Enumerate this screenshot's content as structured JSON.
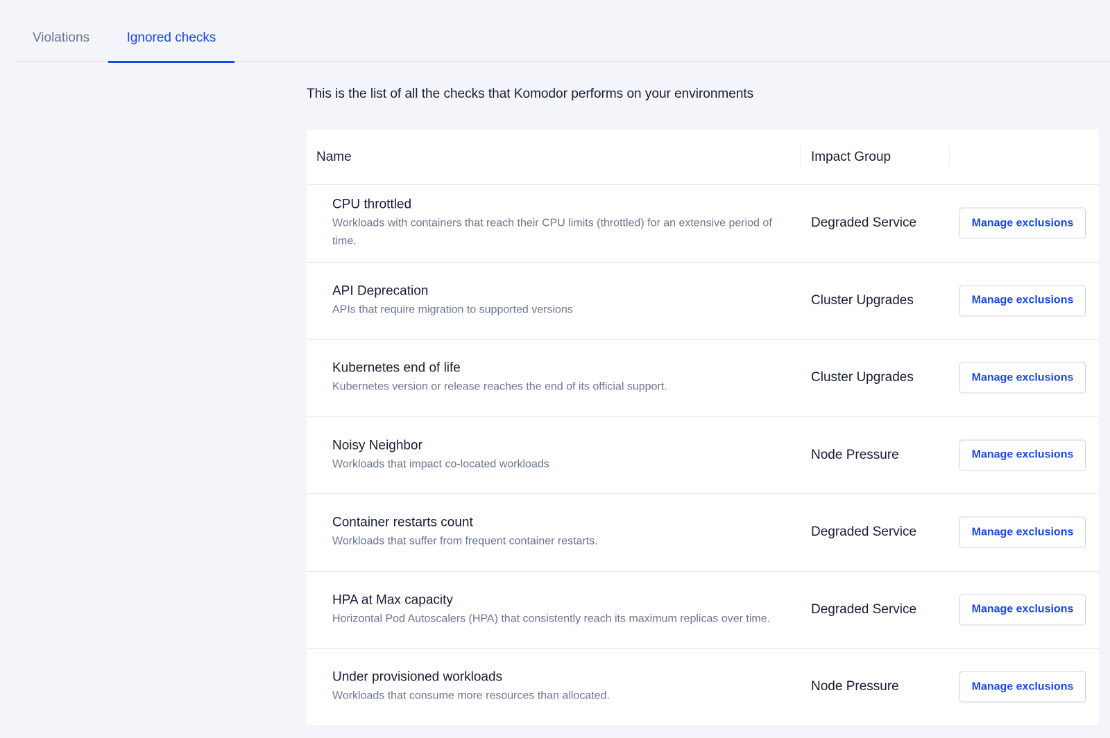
{
  "tabs": [
    {
      "label": "Violations",
      "active": false
    },
    {
      "label": "Ignored checks",
      "active": true
    }
  ],
  "intro": "This is the list of all the checks that Komodor performs on your environments",
  "table": {
    "headers": {
      "name": "Name",
      "impact_group": "Impact Group"
    },
    "rows": [
      {
        "title": "CPU throttled",
        "description": "Workloads with containers that reach their CPU limits (throttled) for an extensive period of time.",
        "impact_group": "Degraded Service",
        "action": "Manage exclusions"
      },
      {
        "title": "API Deprecation",
        "description": "APIs that require migration to supported versions",
        "impact_group": "Cluster Upgrades",
        "action": "Manage exclusions"
      },
      {
        "title": "Kubernetes end of life",
        "description": "Kubernetes version or release reaches the end of its official support.",
        "impact_group": "Cluster Upgrades",
        "action": "Manage exclusions"
      },
      {
        "title": "Noisy Neighbor",
        "description": "Workloads that impact co-located workloads",
        "impact_group": "Node Pressure",
        "action": "Manage exclusions"
      },
      {
        "title": "Container restarts count",
        "description": "Workloads that suffer from frequent container restarts.",
        "impact_group": "Degraded Service",
        "action": "Manage exclusions"
      },
      {
        "title": "HPA at Max capacity",
        "description": "Horizontal Pod Autoscalers (HPA) that consistently reach its maximum replicas over time.",
        "impact_group": "Degraded Service",
        "action": "Manage exclusions"
      },
      {
        "title": "Under provisioned workloads",
        "description": "Workloads that consume more resources than allocated.",
        "impact_group": "Node Pressure",
        "action": "Manage exclusions"
      }
    ]
  },
  "colors": {
    "accent": "#1847e6",
    "text": "#171c33",
    "muted": "#6b7590",
    "background": "#f4f5fa"
  }
}
